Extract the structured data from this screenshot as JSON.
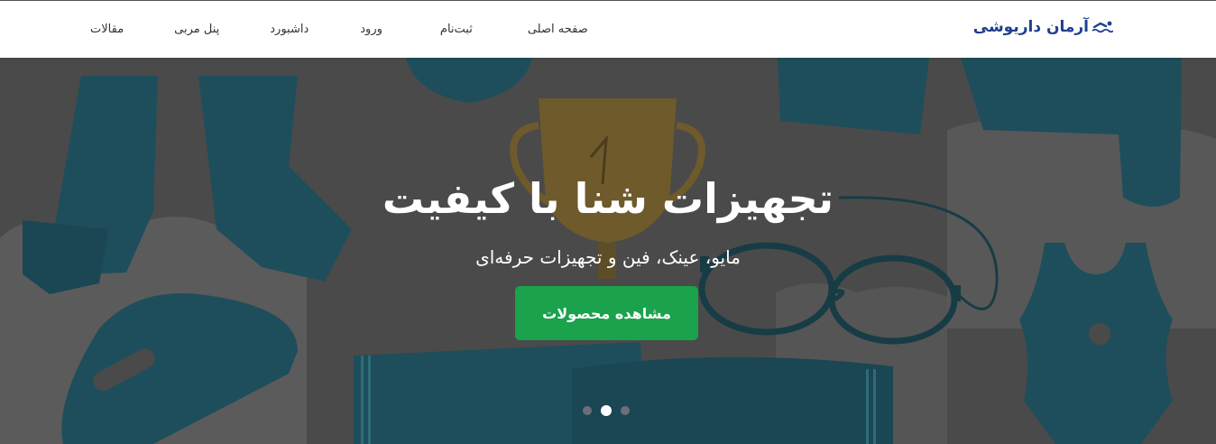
{
  "brand": {
    "name": "آرمان داریوشی",
    "icon": "swimmer-icon",
    "color": "#1f3f8f"
  },
  "nav": {
    "items": [
      {
        "label": "صفحه اصلی"
      },
      {
        "label": "ثبت‌نام"
      },
      {
        "label": "ورود"
      },
      {
        "label": "داشبورد"
      },
      {
        "label": "پنل مربی"
      },
      {
        "label": "مقالات"
      }
    ]
  },
  "hero": {
    "title": "تجهیزات شنا با کیفیت",
    "subtitle": "مایو، عینک، فین و تجهیزات حرفه‌ای",
    "cta_label": "مشاهده محصولات",
    "cta_color": "#1aa24c",
    "carousel": {
      "slides": 3,
      "active_index": 2
    }
  }
}
